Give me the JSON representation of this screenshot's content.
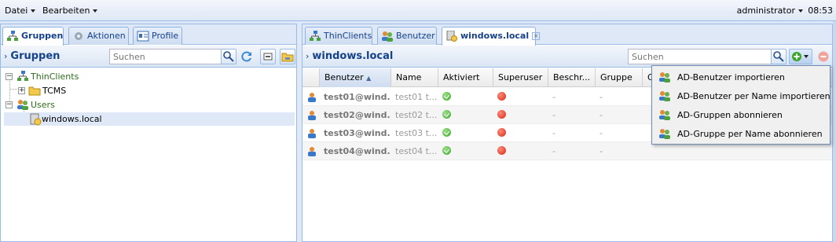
{
  "menubar": {
    "file": "Datei",
    "edit": "Bearbeiten",
    "user": "administrator",
    "time": "08:53"
  },
  "left": {
    "tabs": [
      "Gruppen",
      "Aktionen",
      "Profile"
    ],
    "title": "Gruppen",
    "search_placeholder": "Suchen",
    "tree": {
      "root1": "ThinClients",
      "child1": "TCMS",
      "root2": "Users",
      "child2": "windows.local"
    }
  },
  "right": {
    "tabs": [
      "ThinClients",
      "Benutzer",
      "windows.local"
    ],
    "title": "windows.local",
    "search_placeholder": "Suchen",
    "columns": [
      "Benutzer",
      "Name",
      "Aktiviert",
      "Superuser",
      "Beschr...",
      "Gruppe",
      "G"
    ],
    "rows": [
      {
        "user": "test01@wind...",
        "name": "test01 t...",
        "desc": "-",
        "group": "-"
      },
      {
        "user": "test02@wind...",
        "name": "test02 t...",
        "desc": "-",
        "group": "-"
      },
      {
        "user": "test03@wind...",
        "name": "test03 t...",
        "desc": "-",
        "group": "-"
      },
      {
        "user": "test04@wind...",
        "name": "test04 t...",
        "desc": "-",
        "group": "-"
      }
    ],
    "menu": [
      "AD-Benutzer importieren",
      "AD-Benutzer per Name importieren",
      "AD-Gruppen abonnieren",
      "AD-Gruppe per Name abonnieren"
    ]
  },
  "colors": {
    "accent": "#15428b",
    "border": "#99bbe8",
    "selected": "#dfe8f6"
  }
}
